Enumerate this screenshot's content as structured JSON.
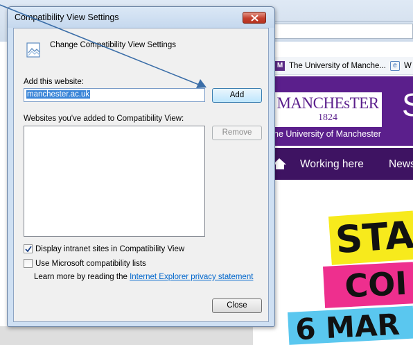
{
  "dialog": {
    "title": "Compatibility View Settings",
    "header_text": "Change Compatibility View Settings",
    "add_label": "Add this website:",
    "url_value": "manchester.ac.uk",
    "add_button": "Add",
    "list_label": "Websites you've added to Compatibility View:",
    "remove_button": "Remove",
    "intranet_checkbox": {
      "label": "Display intranet sites in Compatibility View",
      "checked": true
    },
    "ms_lists_checkbox": {
      "label": "Use Microsoft compatibility lists",
      "checked": false
    },
    "learn_more_prefix": "Learn more by reading the",
    "learn_more_link": "Internet Explorer privacy statement",
    "close_button": "Close"
  },
  "browser": {
    "favorites": [
      {
        "icon": "manchester-favicon",
        "label": "The University of Manche..."
      },
      {
        "icon": "ie-page-icon",
        "label": "W"
      }
    ],
    "logo_name": "MANCHEsTER",
    "logo_year": "1824",
    "logo_partial": "S",
    "university_name": "he University of Manchester",
    "nav": [
      "Working here",
      "News"
    ],
    "banners": [
      "STA",
      "COI",
      "6 MAR"
    ]
  },
  "colors": {
    "manchester_purple": "#5b1f8c",
    "nav_purple": "#3e1362",
    "banner_yellow": "#f7ea1c",
    "banner_pink": "#ee2f8e",
    "banner_cyan": "#5ac7ef",
    "arrow": "#3b6ea8"
  }
}
